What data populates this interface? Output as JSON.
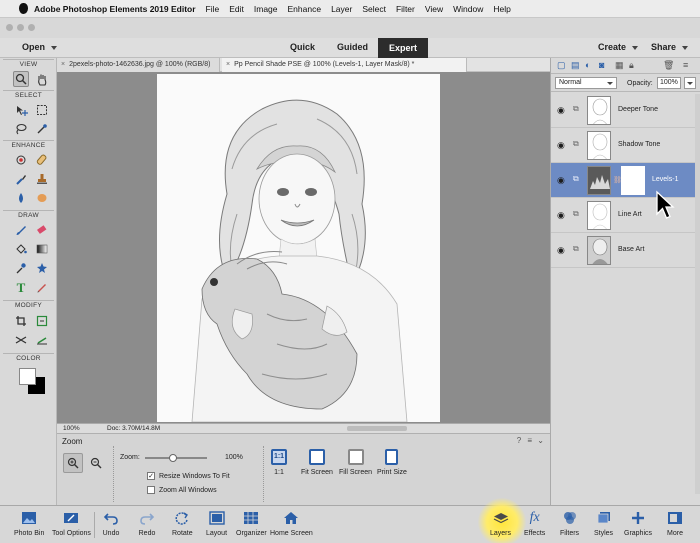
{
  "menubar": {
    "app": "Adobe Photoshop Elements 2019 Editor",
    "items": [
      "File",
      "Edit",
      "Image",
      "Enhance",
      "Layer",
      "Select",
      "Filter",
      "View",
      "Window",
      "Help"
    ]
  },
  "topbar": {
    "open": "Open",
    "modes": [
      "Quick",
      "Guided",
      "Expert"
    ],
    "create": "Create",
    "share": "Share"
  },
  "docs": {
    "tab1": "2pexels-photo-1462636.jpg @ 100% (RGB/8)",
    "tab2": "Pp Pencil Shade PSE @ 100% (Levels-1, Layer Mask/8) *"
  },
  "toolbox": {
    "sections": [
      "VIEW",
      "SELECT",
      "ENHANCE",
      "DRAW",
      "MODIFY",
      "COLOR"
    ]
  },
  "status": {
    "zoom": "100%",
    "doc": "Doc: 3.70M/14.8M"
  },
  "tool_options": {
    "title": "Zoom",
    "zoom_label": "Zoom:",
    "zoom_value": "100%",
    "zoom_level": 0.45,
    "resize_windows": "Resize Windows To Fit",
    "zoom_all": "Zoom All Windows",
    "one_to_one": "1:1",
    "fit_screen": "Fit Screen",
    "fill_screen": "Fill Screen",
    "print_size": "Print Size",
    "one_glyph": "1:1"
  },
  "layers": {
    "blend_mode": "Normal",
    "opacity_label": "Opacity:",
    "opacity_value": "100%",
    "items": [
      {
        "name": "Deeper Tone"
      },
      {
        "name": "Shadow Tone"
      },
      {
        "name": "Levels-1"
      },
      {
        "name": "Line Art"
      },
      {
        "name": "Base Art"
      }
    ]
  },
  "taskbar": {
    "left": [
      "Photo Bin",
      "Tool Options",
      "Undo",
      "Redo",
      "Rotate",
      "Layout",
      "Organizer",
      "Home Screen"
    ],
    "right": [
      "Layers",
      "Effects",
      "Filters",
      "Styles",
      "Graphics",
      "More"
    ]
  },
  "colors": {
    "accent": "#2b5fa8",
    "active_layer": "#6d8bc4",
    "highlight": "#ffe53b"
  }
}
